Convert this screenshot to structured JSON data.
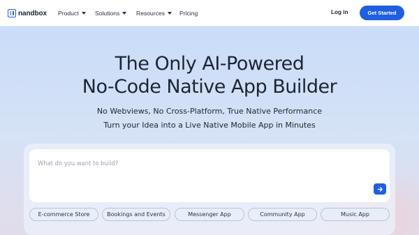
{
  "brand": {
    "name": "nandbox"
  },
  "nav": [
    {
      "label": "Product",
      "has_menu": true
    },
    {
      "label": "Solutions",
      "has_menu": true
    },
    {
      "label": "Resources",
      "has_menu": true
    },
    {
      "label": "Pricing",
      "has_menu": false
    }
  ],
  "header": {
    "login_label": "Log in",
    "cta_label": "Get Started"
  },
  "hero": {
    "title_line1": "The Only AI-Powered",
    "title_line2": "No-Code Native App Builder",
    "subtitle_line1": "No Webviews, No Cross-Platform, True Native Performance",
    "subtitle_line2": "Turn your Idea into a Live Native Mobile App in Minutes"
  },
  "prompt": {
    "placeholder": "What do you want to build?",
    "send_icon": "arrow-right-icon"
  },
  "chips": [
    "E-commerce Store",
    "Bookings and Events",
    "Messenger App",
    "Community App",
    "Music App"
  ],
  "colors": {
    "accent": "#1f5fe0",
    "text": "#1d2433",
    "hero_top": "#c9dcf8",
    "hero_bottom": "#e2dcea"
  }
}
